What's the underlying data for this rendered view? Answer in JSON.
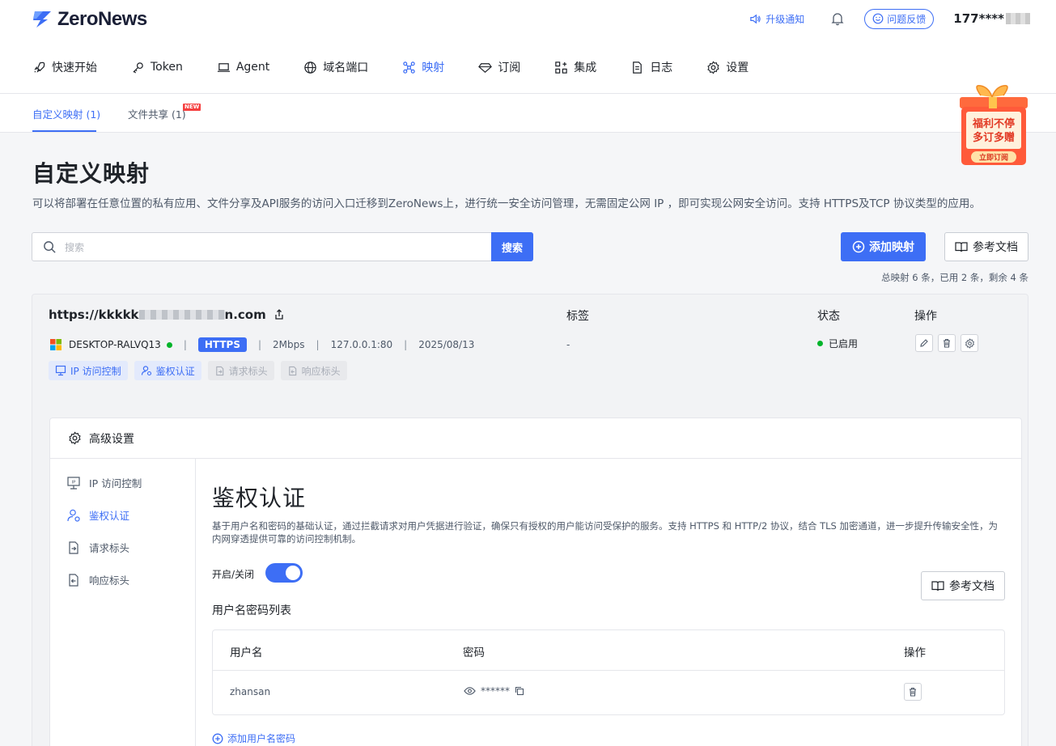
{
  "header": {
    "brand": "ZeroNews",
    "upgrade_label": "升级通知",
    "feedback_label": "问题反馈",
    "user_name": "177****"
  },
  "nav": [
    {
      "label": "快速开始",
      "icon": "rocket-icon"
    },
    {
      "label": "Token",
      "icon": "key-icon"
    },
    {
      "label": "Agent",
      "icon": "laptop-icon"
    },
    {
      "label": "域名端口",
      "icon": "globe-icon"
    },
    {
      "label": "映射",
      "icon": "mapping-icon",
      "active": true
    },
    {
      "label": "订阅",
      "icon": "diamond-icon"
    },
    {
      "label": "集成",
      "icon": "grid-icon"
    },
    {
      "label": "日志",
      "icon": "document-icon"
    },
    {
      "label": "设置",
      "icon": "gear-icon"
    }
  ],
  "subtabs": [
    {
      "label": "自定义映射 (1)",
      "active": true
    },
    {
      "label": "文件共享 (1)",
      "badge": "NEW"
    }
  ],
  "promo": {
    "line1": "福利不停",
    "line2": "多订多赠",
    "button": "立即订阅"
  },
  "page": {
    "title": "自定义映射",
    "description": "可以将部署在任意位置的私有应用、文件分享及API服务的访问入口迁移到ZeroNews上，进行统一安全访问管理，无需固定公网 IP ，即可实现公网安全访问。支持 HTTPS及TCP 协议类型的应用。",
    "search_placeholder": "搜索",
    "search_button": "搜索",
    "add_button": "添加映射",
    "docs_button": "参考文档",
    "summary": "总映射 6 条，已用 2 条，剩余 4 条"
  },
  "mapping": {
    "url_prefix": "https://kkkkk",
    "url_suffix": "n.com",
    "col_tags": "标签",
    "col_status": "状态",
    "col_ops": "操作",
    "agent": "DESKTOP-RALVQ13",
    "protocol": "HTTPS",
    "bandwidth": "2Mbps",
    "local_addr": "127.0.0.1:80",
    "date": "2025/08/13",
    "tag_value": "-",
    "status": "已启用",
    "chips": [
      {
        "label": "IP 访问控制",
        "enabled": true
      },
      {
        "label": "鉴权认证",
        "enabled": true
      },
      {
        "label": "请求标头",
        "enabled": false
      },
      {
        "label": "响应标头",
        "enabled": false
      }
    ]
  },
  "advanced": {
    "title": "高级设置",
    "side_items": [
      {
        "label": "IP 访问控制"
      },
      {
        "label": "鉴权认证",
        "active": true
      },
      {
        "label": "请求标头"
      },
      {
        "label": "响应标头"
      }
    ],
    "section_title": "鉴权认证",
    "section_desc": "基于用户名和密码的基础认证，通过拦截请求对用户凭据进行验证，确保只有授权的用户能访问受保护的服务。支持 HTTPS 和 HTTP/2 协议，结合 TLS 加密通道，进一步提升传输安全性，为内网穿透提供可靠的访问控制机制。",
    "toggle_label": "开启/关闭",
    "toggle_on": true,
    "docs_button": "参考文档",
    "list_title": "用户名密码列表",
    "table_headers": {
      "username": "用户名",
      "password": "密码",
      "ops": "操作"
    },
    "rows": [
      {
        "username": "zhansan",
        "password": "******"
      }
    ],
    "add_link": "添加用户名密码"
  },
  "colors": {
    "accent": "#3d6ef5",
    "status_green": "#00b42a"
  }
}
